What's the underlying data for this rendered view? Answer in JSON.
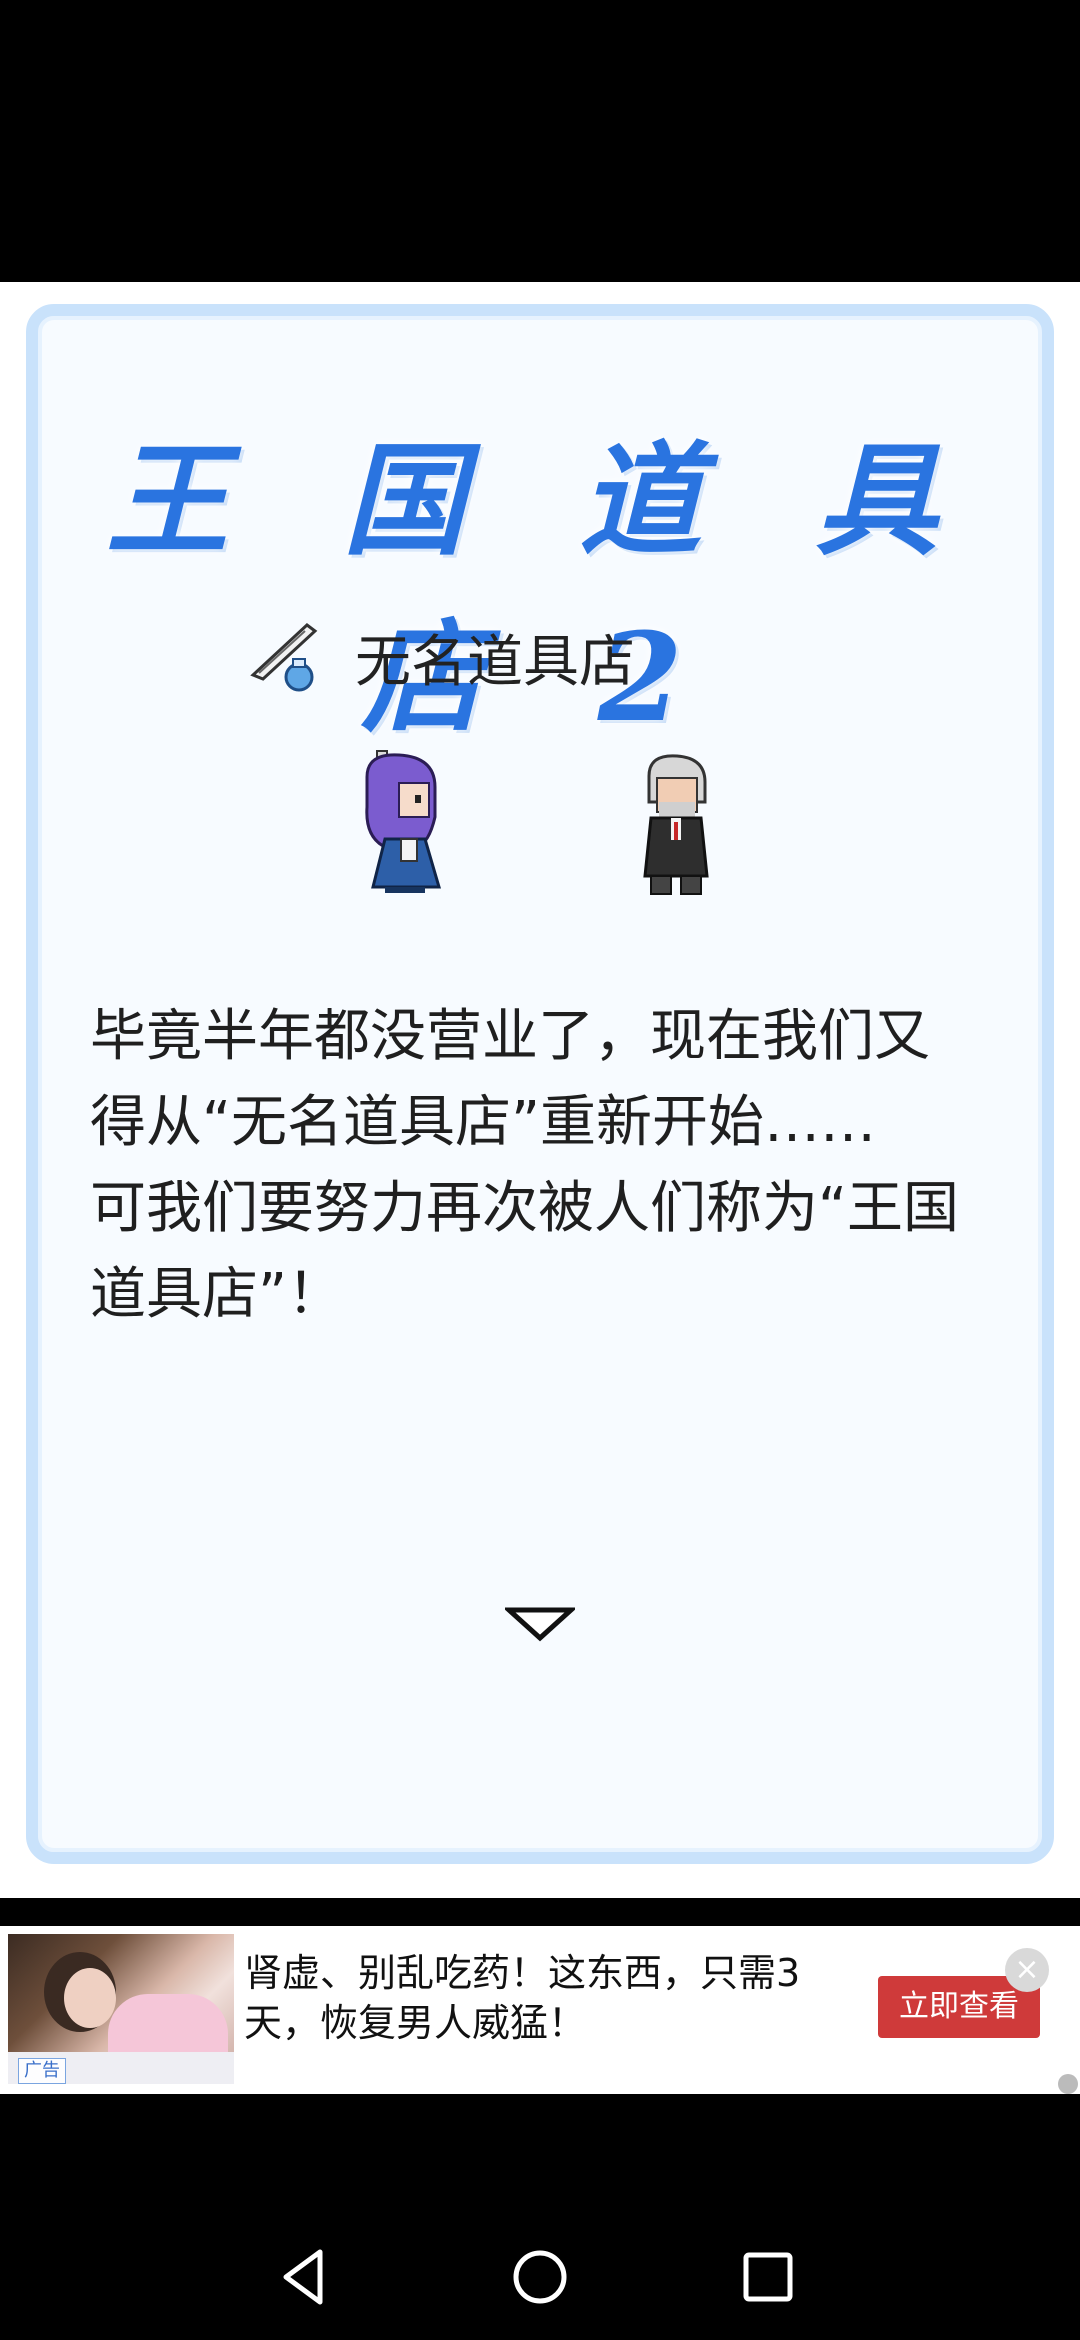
{
  "game": {
    "title": "王 国 道 具 店 2",
    "shop_name": "无名道具店",
    "dialog": "毕竟半年都没营业了，现在我们又\n得从“无名道具店”重新开始……\n可我们要努力再次被人们称为“王国\n道具店”！",
    "icons": {
      "shop": "quill-ink-icon",
      "next": "down-triangle-icon",
      "girl": "purple-hair-girl-sprite",
      "man": "old-gentleman-sprite"
    }
  },
  "ad": {
    "label": "广告",
    "text": "肾虚、别乱吃药！这东西，只需3天，恢复男人威猛！",
    "button": "立即查看",
    "close": "×"
  },
  "nav": {
    "back": "back-icon",
    "home": "home-icon",
    "recent": "recent-apps-icon"
  },
  "colors": {
    "title": "#2a74e0",
    "panel_border": "#c9e2fb",
    "ad_button": "#cf3a3a"
  }
}
